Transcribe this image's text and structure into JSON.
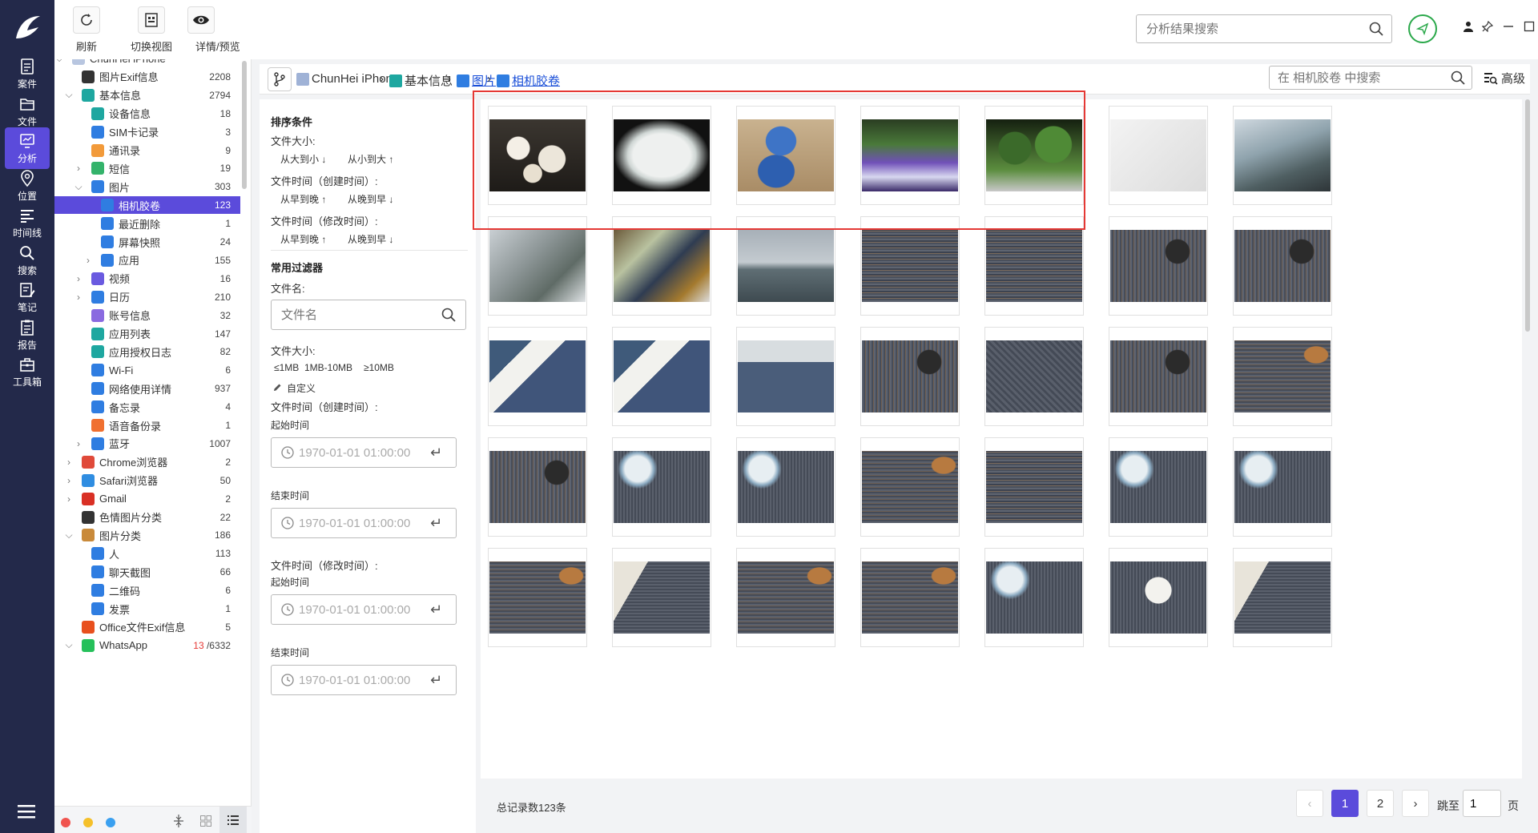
{
  "nav": {
    "items": [
      {
        "label": "案件",
        "icon": "case-icon"
      },
      {
        "label": "文件",
        "icon": "file-icon"
      },
      {
        "label": "分析",
        "icon": "analysis-icon"
      },
      {
        "label": "位置",
        "icon": "location-icon"
      },
      {
        "label": "时间线",
        "icon": "timeline-icon"
      },
      {
        "label": "搜索",
        "icon": "search-icon"
      },
      {
        "label": "笔记",
        "icon": "note-icon"
      },
      {
        "label": "报告",
        "icon": "report-icon"
      },
      {
        "label": "工具箱",
        "icon": "toolbox-icon"
      }
    ],
    "active_index": 2
  },
  "toolbar": {
    "refresh_label": "刷新",
    "switch_view_label": "切换视图",
    "detail_label": "详情/预览",
    "search_placeholder": "分析结果搜索"
  },
  "tree": {
    "items": [
      {
        "label": "ChunHei iPhone",
        "count": "",
        "level": 0,
        "chev": "v",
        "icon": "iphone-icon",
        "color": "#b8c6e0"
      },
      {
        "label": "图片Exif信息",
        "count": "2208",
        "level": 1,
        "chev": "",
        "icon": "image-icon",
        "color": "#333333"
      },
      {
        "label": "基本信息",
        "count": "2794",
        "level": 1,
        "chev": "v",
        "icon": "basic-info-icon",
        "color": "#1ea7a0"
      },
      {
        "label": "设备信息",
        "count": "18",
        "level": 2,
        "chev": "",
        "icon": "device-icon",
        "color": "#1ea7a0"
      },
      {
        "label": "SIM卡记录",
        "count": "3",
        "level": 2,
        "chev": "",
        "icon": "sim-icon",
        "color": "#2f7de1"
      },
      {
        "label": "通讯录",
        "count": "9",
        "level": 2,
        "chev": "",
        "icon": "contacts-icon",
        "color": "#f29a3a"
      },
      {
        "label": "短信",
        "count": "19",
        "level": 2,
        "chev": ">",
        "icon": "sms-icon",
        "color": "#34b36b"
      },
      {
        "label": "图片",
        "count": "303",
        "level": 2,
        "chev": "v",
        "icon": "photo-icon",
        "color": "#2f7de1"
      },
      {
        "label": "相机胶卷",
        "count": "123",
        "level": 3,
        "chev": "",
        "icon": "photo-icon",
        "color": "#2f7de1"
      },
      {
        "label": "最近删除",
        "count": "1",
        "level": 3,
        "chev": "",
        "icon": "photo-icon",
        "color": "#2f7de1"
      },
      {
        "label": "屏幕快照",
        "count": "24",
        "level": 3,
        "chev": "",
        "icon": "photo-icon",
        "color": "#2f7de1"
      },
      {
        "label": "应用",
        "count": "155",
        "level": 3,
        "chev": ">",
        "icon": "photo-icon",
        "color": "#2f7de1"
      },
      {
        "label": "视频",
        "count": "16",
        "level": 2,
        "chev": ">",
        "icon": "video-icon",
        "color": "#6a5ae0"
      },
      {
        "label": "日历",
        "count": "210",
        "level": 2,
        "chev": ">",
        "icon": "calendar-icon",
        "color": "#2f7de1"
      },
      {
        "label": "账号信息",
        "count": "32",
        "level": 2,
        "chev": "",
        "icon": "account-icon",
        "color": "#8a6ae0"
      },
      {
        "label": "应用列表",
        "count": "147",
        "level": 2,
        "chev": "",
        "icon": "app-list-icon",
        "color": "#1ea7a0"
      },
      {
        "label": "应用授权日志",
        "count": "82",
        "level": 2,
        "chev": "",
        "icon": "app-auth-icon",
        "color": "#1ea7a0"
      },
      {
        "label": "Wi-Fi",
        "count": "6",
        "level": 2,
        "chev": "",
        "icon": "wifi-icon",
        "color": "#2f7de1"
      },
      {
        "label": "网络使用详情",
        "count": "937",
        "level": 2,
        "chev": "",
        "icon": "network-icon",
        "color": "#2f7de1"
      },
      {
        "label": "备忘录",
        "count": "4",
        "level": 2,
        "chev": "",
        "icon": "memo-icon",
        "color": "#2f7de1"
      },
      {
        "label": "语音备份录",
        "count": "1",
        "level": 2,
        "chev": "",
        "icon": "voice-icon",
        "color": "#f07030"
      },
      {
        "label": "蓝牙",
        "count": "1007",
        "level": 2,
        "chev": ">",
        "icon": "bluetooth-icon",
        "color": "#2f7de1"
      },
      {
        "label": "Chrome浏览器",
        "count": "2",
        "level": 1,
        "chev": ">",
        "icon": "chrome-icon",
        "color": "#e04a3a"
      },
      {
        "label": "Safari浏览器",
        "count": "50",
        "level": 1,
        "chev": ">",
        "icon": "safari-icon",
        "color": "#2f8de1"
      },
      {
        "label": "Gmail",
        "count": "2",
        "level": 1,
        "chev": ">",
        "icon": "gmail-icon",
        "color": "#d93025"
      },
      {
        "label": "色情图片分类",
        "count": "22",
        "level": 1,
        "chev": "",
        "icon": "image-icon",
        "color": "#333333"
      },
      {
        "label": "图片分类",
        "count": "186",
        "level": 1,
        "chev": "v",
        "icon": "image-class-icon",
        "color": "#c98a3a"
      },
      {
        "label": "人",
        "count": "113",
        "level": 2,
        "chev": "",
        "icon": "photo-icon",
        "color": "#2f7de1"
      },
      {
        "label": "聊天截图",
        "count": "66",
        "level": 2,
        "chev": "",
        "icon": "photo-icon",
        "color": "#2f7de1"
      },
      {
        "label": "二维码",
        "count": "6",
        "level": 2,
        "chev": "",
        "icon": "photo-icon",
        "color": "#2f7de1"
      },
      {
        "label": "发票",
        "count": "1",
        "level": 2,
        "chev": "",
        "icon": "photo-icon",
        "color": "#2f7de1"
      },
      {
        "label": "Office文件Exif信息",
        "count": "5",
        "level": 1,
        "chev": "",
        "icon": "office-icon",
        "color": "#e8501e"
      },
      {
        "label": "WhatsApp",
        "count": "/6332",
        "count_red": "13",
        "level": 1,
        "chev": "v",
        "icon": "whatsapp-icon",
        "color": "#25c05a"
      }
    ],
    "selected_index": 8
  },
  "breadcrumb": {
    "items": [
      {
        "label": "ChunHei iPhone",
        "icon": "iphone-icon",
        "link": false
      },
      {
        "label": "基本信息",
        "icon": "basic-info-icon",
        "link": false
      },
      {
        "label": "图片",
        "icon": "photo-icon",
        "link": true
      },
      {
        "label": "相机胶卷",
        "icon": "photo-icon",
        "link": true
      }
    ],
    "search_placeholder": "在 相机胶卷 中搜索",
    "advanced_label": "高级"
  },
  "filters": {
    "sort_title": "排序条件",
    "size_label": "文件大小:",
    "size_desc": "从大到小",
    "size_asc": "从小到大",
    "ctime_label": "文件时间（创建时间）:",
    "mtime_label": "文件时间（修改时间）:",
    "early_late": "从早到晚",
    "late_early": "从晚到早",
    "common_title": "常用过滤器",
    "filename_label": "文件名:",
    "filename_placeholder": "文件名",
    "size_filter_label": "文件大小:",
    "size_opts": [
      "≤1MB",
      "1MB-10MB",
      "≥10MB"
    ],
    "custom_label": "自定义",
    "filter_ctime_label": "文件时间（创建时间）:",
    "start_label": "起始时间",
    "end_label": "结束时间",
    "filter_mtime_label": "文件时间（修改时间）:",
    "date_value": "1970-01-01 01:00:00"
  },
  "grid": {
    "photos": [
      "crystals-white",
      "crystals-powder",
      "blue-pills",
      "plants-grow-light",
      "plants-green",
      "handwritten-note",
      "city-view",
      "window-view",
      "cluttered-desk",
      "city-skyline",
      "carpet",
      "carpet",
      "carpet-chair",
      "carpet-chair",
      "carpet-table",
      "carpet-table",
      "office-room",
      "carpet-chair",
      "carpet-square",
      "carpet-chair",
      "carpet-shoe",
      "carpet-chair",
      "carpet-bottle",
      "carpet-bottle",
      "carpet-shoe",
      "carpet",
      "carpet-bottle",
      "carpet-bottle",
      "carpet-shoe",
      "carpet-bag",
      "carpet-shoe",
      "carpet-shoe",
      "carpet-bottle",
      "carpet-fan",
      "carpet-bag"
    ],
    "selected_highlight_count": 5
  },
  "pager": {
    "total": "总记录数123条",
    "pages": [
      "1",
      "2"
    ],
    "active_page": "1",
    "jump_label": "跳至",
    "jump_value": "1",
    "page_unit": "页"
  }
}
